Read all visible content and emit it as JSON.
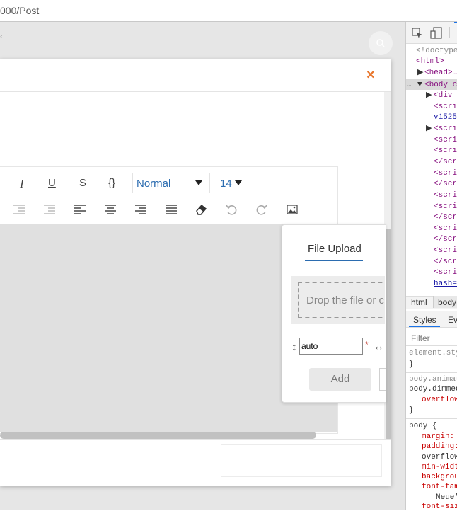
{
  "browser": {
    "url": "000/Post"
  },
  "modal": {
    "close_label": "×"
  },
  "editor": {
    "toolbar_row1": {
      "italic": "I",
      "underline": "U",
      "strike": "S",
      "code": "{}"
    },
    "style_select": {
      "value": "Normal"
    },
    "size_select": {
      "value": "14"
    }
  },
  "file_upload": {
    "tab_label": "File Upload",
    "drop_text": "Drop the file or cl",
    "height_value": "auto",
    "required_mark": "*",
    "add_label": "Add"
  },
  "devtools": {
    "html_lines": [
      "<!doctype",
      "<html>",
      "<head>…",
      "<body c",
      "<div i",
      "<scri",
      "v1525",
      "<scrip",
      "<scri",
      "<scri",
      "</scr",
      "<scri",
      "</scr",
      "<scri",
      "<scri",
      "</scr",
      "<scri",
      "</scr",
      "<scri",
      "</scr",
      "<scri",
      "hash="
    ],
    "crumb_html": "html",
    "crumb_body": "body",
    "tab_styles": "Styles",
    "tab_event": "Ev",
    "filter_placeholder": "Filter",
    "style_lines": {
      "element_style": "element.sty",
      "close1": "}",
      "body_anim": "body.animat",
      "body_dimmed": "body.dimmed",
      "overflow": "overflow",
      "close2": "}",
      "body_open": "body {",
      "margin": "margin:",
      "padding": "padding:",
      "overflow_strike": "overflow",
      "min_width": "min-widt",
      "background": "backgrou",
      "font_family": "font-fam",
      "neue": "Neue'",
      "font_size": "font-siz"
    }
  },
  "colors": {
    "accent": "#2b6cb0",
    "close": "#e8762c",
    "required": "#c0392b"
  }
}
